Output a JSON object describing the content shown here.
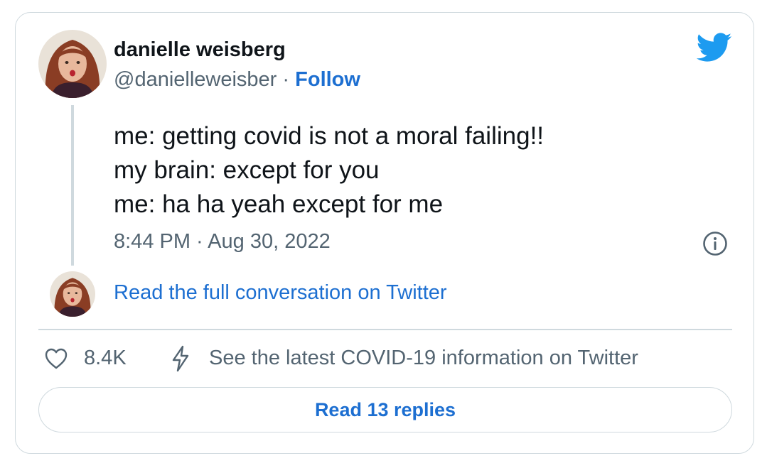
{
  "author": {
    "name": "danielle weisberg",
    "handle": "@danielleweisber",
    "separator": "·",
    "follow_label": "Follow"
  },
  "tweet": {
    "lines": [
      "me: getting covid is not a moral failing!!",
      "my brain: except for you",
      "me: ha ha yeah except for me"
    ],
    "timestamp": "8:44 PM · Aug 30, 2022"
  },
  "conversation": {
    "link_label": "Read the full conversation on Twitter"
  },
  "actions": {
    "like_count": "8.4K",
    "covid_info_label": "See the latest COVID-19 information on Twitter",
    "replies_label": "Read 13 replies"
  },
  "icons": {
    "brand": "twitter-bird-icon",
    "info": "info-icon",
    "like": "heart-icon",
    "covid": "lightning-bolt-icon"
  },
  "colors": {
    "accent": "#1d6fd1",
    "twitter_blue": "#1d9bf0",
    "text": "#0f1419",
    "muted": "#536471",
    "border": "#cfd9de"
  }
}
